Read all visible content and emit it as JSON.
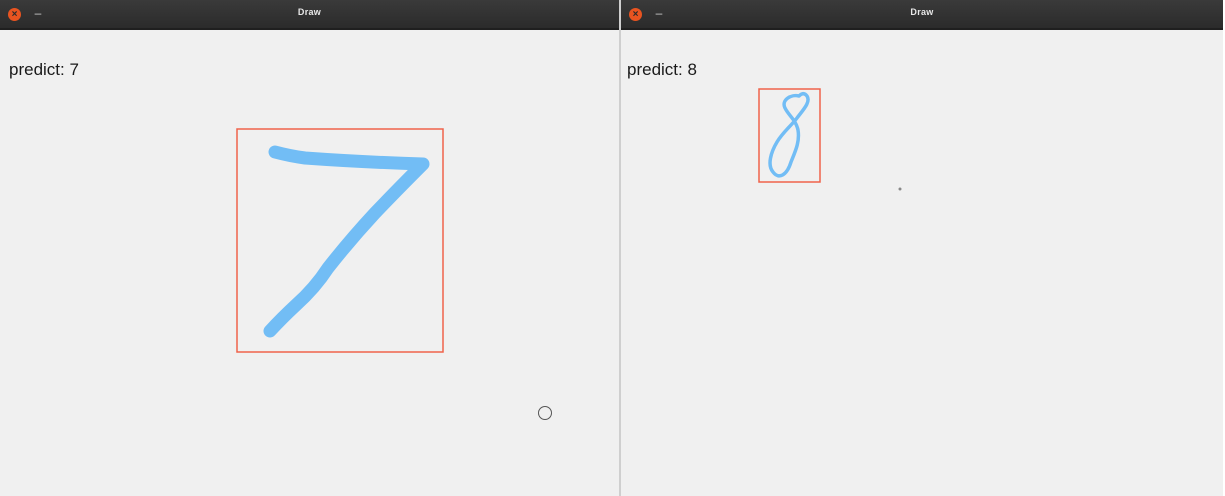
{
  "windows": [
    {
      "title": "Draw",
      "predict_label": "predict: 7",
      "close_icon_glyph": "×",
      "minimize_glyph": "–",
      "stroke_color": "#72bdf5",
      "box_color": "#f0624a"
    },
    {
      "title": "Draw",
      "predict_label": "predict: 8",
      "close_icon_glyph": "×",
      "minimize_glyph": "–",
      "stroke_color": "#72bdf5",
      "box_color": "#f0624a"
    }
  ]
}
